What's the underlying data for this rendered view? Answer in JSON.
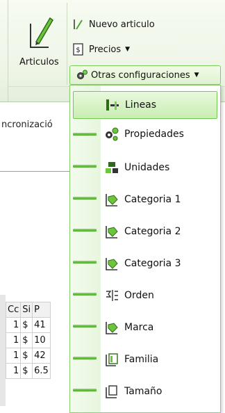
{
  "ribbon": {
    "big_button_label": "Articulos",
    "nuevo_label": "Nuevo articulo",
    "precios_label": "Precios",
    "otras_label": "Otras configuraciones"
  },
  "background": {
    "sync_text": "ncronizació",
    "grid_headers": [
      "Cc",
      "Si",
      "P"
    ],
    "grid_rows": [
      [
        "1",
        "$",
        "41"
      ],
      [
        "1",
        "$",
        "10"
      ],
      [
        "1",
        "$",
        "42"
      ],
      [
        "1",
        "$",
        "6.5"
      ]
    ]
  },
  "menu": {
    "items": [
      {
        "label": "Lineas",
        "icon": "lineas-icon"
      },
      {
        "label": "Propiedades",
        "icon": "propiedades-icon"
      },
      {
        "label": "Unidades",
        "icon": "unidades-icon"
      },
      {
        "label": "Categoria 1",
        "icon": "categoria-icon"
      },
      {
        "label": "Categoria 2",
        "icon": "categoria-icon"
      },
      {
        "label": "Categoria 3",
        "icon": "categoria-icon"
      },
      {
        "label": "Orden",
        "icon": "orden-icon"
      },
      {
        "label": "Marca",
        "icon": "marca-icon"
      },
      {
        "label": "Familia",
        "icon": "familia-icon"
      },
      {
        "label": "Tamaño",
        "icon": "tamano-icon"
      }
    ]
  },
  "colors": {
    "accent_green": "#7ccf5e",
    "highlight_green": "#c9eeb2"
  }
}
